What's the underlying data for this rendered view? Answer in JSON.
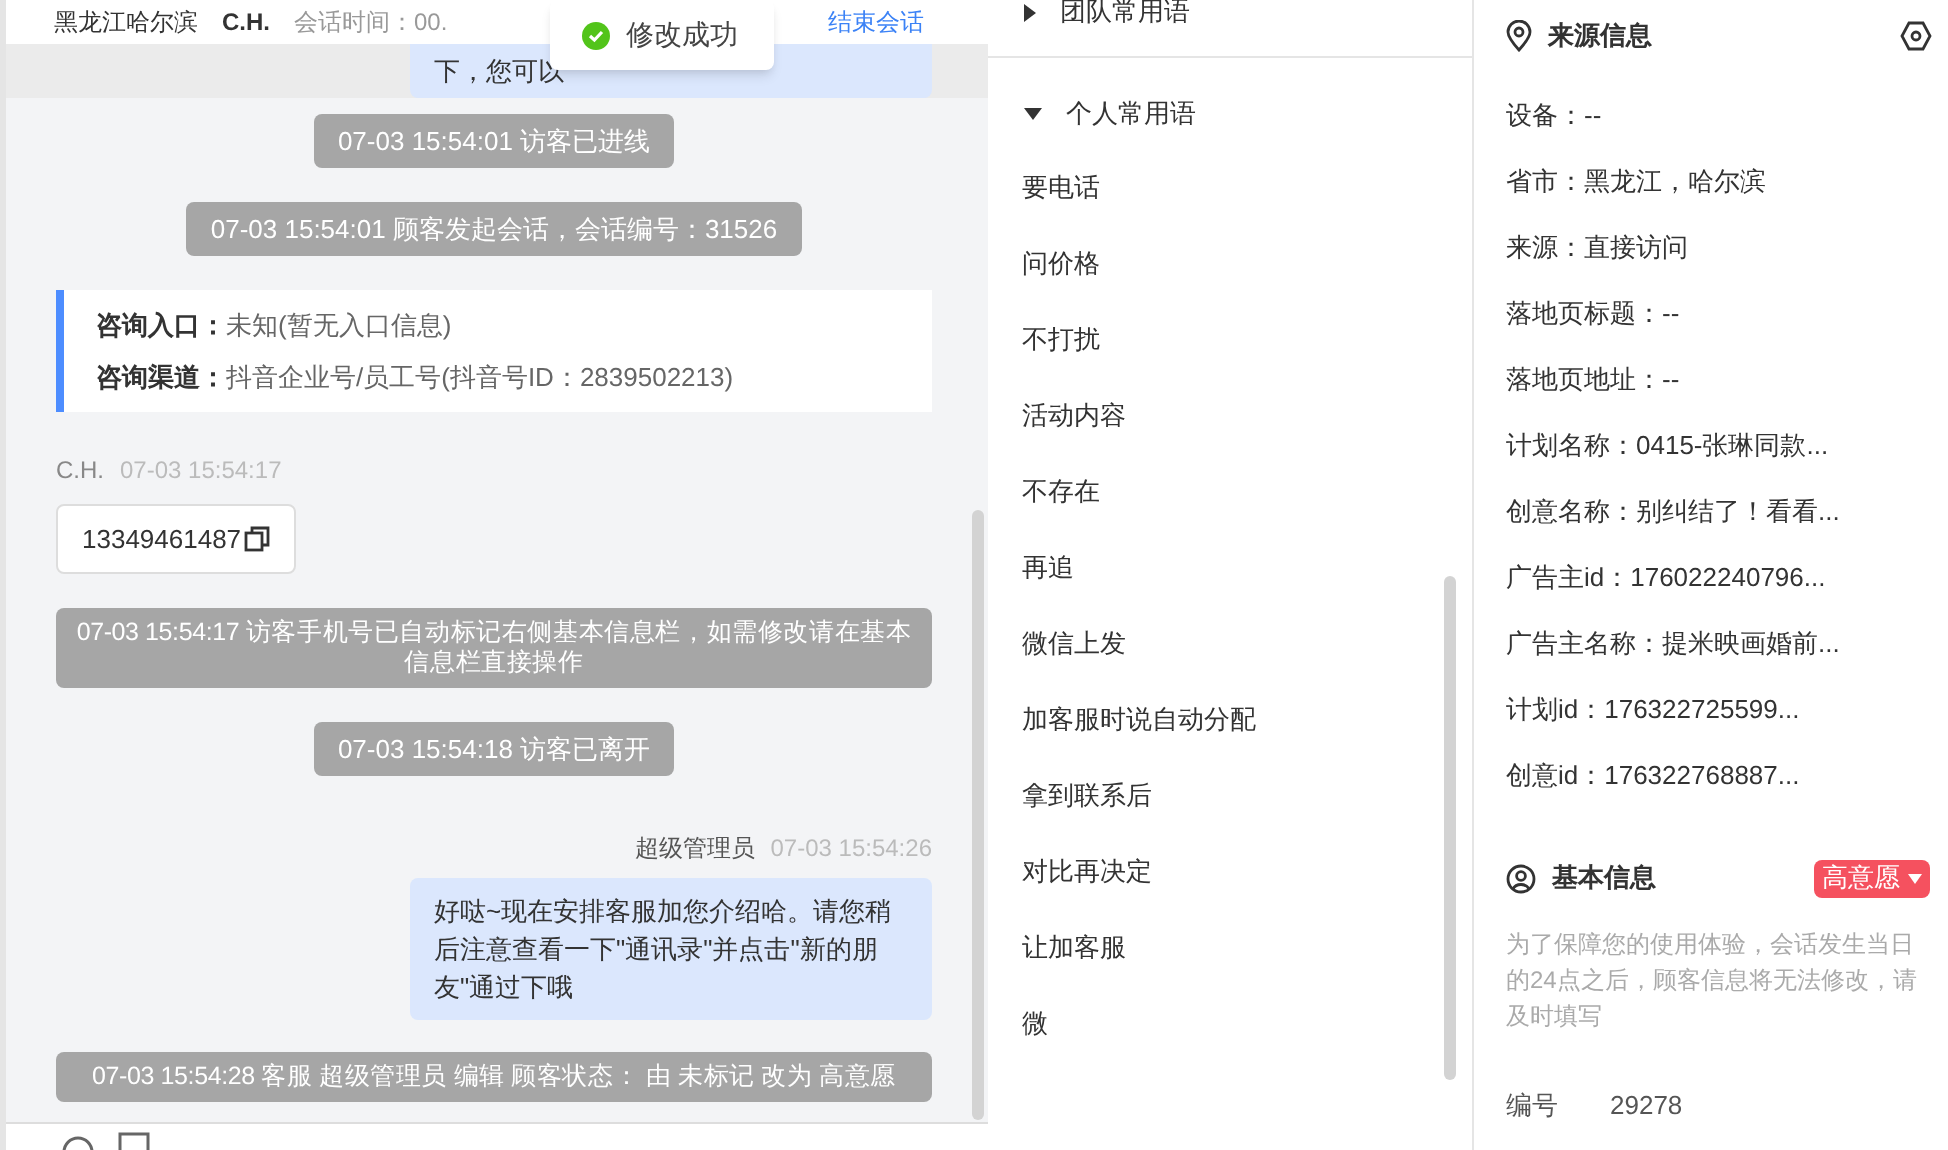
{
  "header": {
    "location": "黑龙江哈尔滨",
    "visitor": "C.H.",
    "session_time": "会话时间：00.",
    "end_button": "结束会话"
  },
  "toast": {
    "text": "修改成功"
  },
  "chat": {
    "messages": [
      {
        "kind": "partial_agent",
        "text": "下，您可以"
      },
      {
        "kind": "system",
        "text": "07-03 15:54:01 访客已进线"
      },
      {
        "kind": "system",
        "text": "07-03 15:54:01 顾客发起会话，会话编号：31526"
      },
      {
        "kind": "info_card",
        "rows": [
          {
            "label": "咨询入口：",
            "value": "未知(暂无入口信息)"
          },
          {
            "label": "咨询渠道：",
            "value": "抖音企业号/员工号(抖音号ID：2839502213)"
          }
        ]
      },
      {
        "kind": "visitor",
        "name": "C.H.",
        "time": "07-03 15:54:17",
        "text": "13349461487"
      },
      {
        "kind": "system_wide",
        "text": "07-03 15:54:17 访客手机号已自动标记右侧基本信息栏，如需修改请在基本信息栏直接操作"
      },
      {
        "kind": "system",
        "text": "07-03 15:54:18 访客已离开"
      },
      {
        "kind": "agent",
        "name": "超级管理员",
        "time": "07-03 15:54:26",
        "text": "好哒~现在安排客服加您介绍哈。请您稍后注意查看一下\"通讯录\"并点击\"新的朋友\"通过下哦"
      },
      {
        "kind": "system_wide",
        "text": "07-03 15:54:28 客服 超级管理员 编辑 顾客状态： 由 未标记 改为 高意愿"
      }
    ]
  },
  "quick_replies": {
    "groups": [
      {
        "label": "团队常用语",
        "expanded": false
      },
      {
        "label": "个人常用语",
        "expanded": true
      }
    ],
    "items": [
      "要电话",
      "问价格",
      "不打扰",
      "活动内容",
      "不存在",
      "再追",
      "微信上发",
      "加客服时说自动分配",
      "拿到联系后",
      "对比再决定",
      "让加客服",
      "微"
    ]
  },
  "source_info": {
    "title": "来源信息",
    "rows": [
      "设备：--",
      "省市：黑龙江，哈尔滨",
      "来源：直接访问",
      "落地页标题：--",
      "落地页地址：--",
      "计划名称：0415-张琳同款...",
      "创意名称：别纠结了！看看...",
      "广告主id：176022240796...",
      "广告主名称：提米映画婚前...",
      "计划id：176322725599...",
      "创意id：176322768887..."
    ]
  },
  "basic_info": {
    "title": "基本信息",
    "status": "高意愿",
    "note": "为了保障您的使用体验，会话发生当日的24点之后，顾客信息将无法修改，请及时填写",
    "fields": [
      {
        "label": "编号",
        "value": "29278"
      }
    ]
  }
}
